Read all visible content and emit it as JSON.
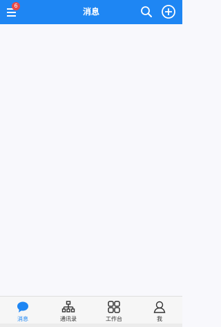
{
  "header": {
    "title": "消息",
    "badge_count": "6",
    "menu_icon": "menu-icon",
    "search_icon": "search-icon",
    "add_icon": "add-circle-icon"
  },
  "tabs": [
    {
      "label": "消息",
      "icon": "chat-bubble-icon",
      "active": true
    },
    {
      "label": "通讯录",
      "icon": "org-chart-icon",
      "active": false
    },
    {
      "label": "工作台",
      "icon": "grid-icon",
      "active": false
    },
    {
      "label": "我",
      "icon": "user-icon",
      "active": false
    }
  ],
  "colors": {
    "primary": "#1e86f3",
    "badge": "#e74a4a",
    "background": "#f8f8fc"
  }
}
